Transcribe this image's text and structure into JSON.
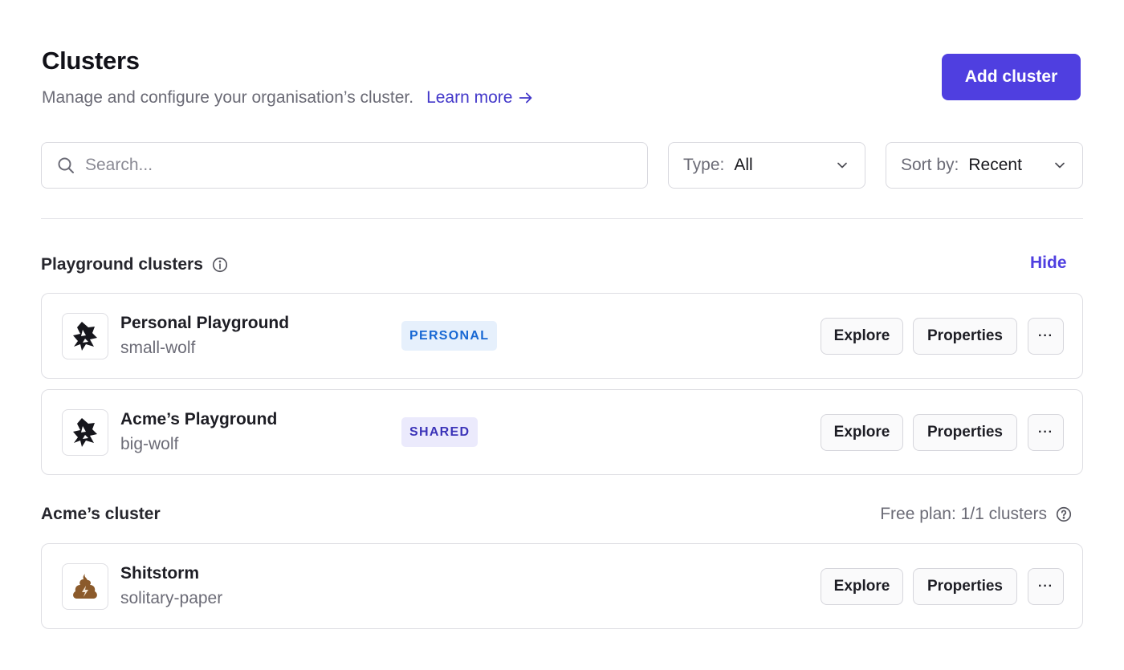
{
  "header": {
    "title": "Clusters",
    "subtitle": "Manage and configure your organisation’s cluster.",
    "learn_more": "Learn more",
    "add_button": "Add cluster"
  },
  "filters": {
    "search_placeholder": "Search...",
    "type_label": "Type:",
    "type_value": "All",
    "sort_label": "Sort by:",
    "sort_value": "Recent"
  },
  "playground": {
    "title": "Playground clusters",
    "hide": "Hide",
    "items": [
      {
        "name": "Personal Playground",
        "slug": "small-wolf",
        "badge": "PERSONAL"
      },
      {
        "name": "Acme’s Playground",
        "slug": "big-wolf",
        "badge": "SHARED"
      }
    ]
  },
  "org": {
    "title": "Acme’s cluster",
    "plan": "Free plan: 1/1 clusters",
    "items": [
      {
        "name": "Shitstorm",
        "slug": "solitary-paper"
      }
    ]
  },
  "actions": {
    "explore": "Explore",
    "properties": "Properties",
    "more": "···"
  },
  "colors": {
    "accent": "#4f3fe0",
    "link": "#4338ca",
    "personal_badge": "#1767d3",
    "shared_badge": "#3b33b8",
    "poop": "#8b5a2b"
  },
  "icons": [
    "search-icon",
    "chevron-down-icon",
    "arrow-right-icon",
    "info-icon",
    "help-icon",
    "wolf-icon",
    "poop-icon"
  ]
}
